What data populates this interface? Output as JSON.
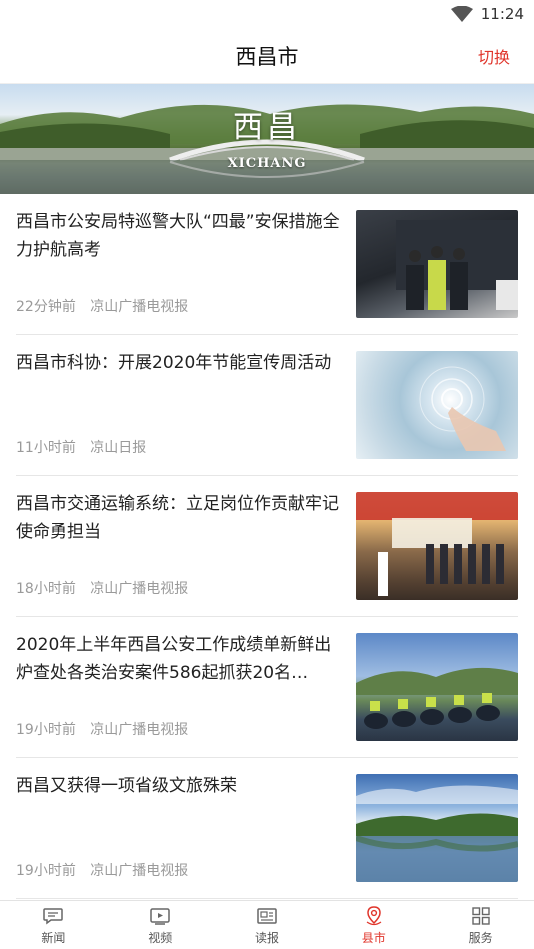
{
  "status_bar": {
    "time": "11:24"
  },
  "header": {
    "title": "西昌市",
    "switch_label": "切换"
  },
  "banner": {
    "title": "西昌",
    "subtitle": "XICHANG"
  },
  "news": [
    {
      "title": "西昌市公安局特巡警大队“四最”安保措施全力护航高考",
      "time": "22分钟前",
      "source": "凉山广播电视报"
    },
    {
      "title": "西昌市科协：开展2020年节能宣传周活动",
      "time": "11小时前",
      "source": "凉山日报"
    },
    {
      "title": "西昌市交通运输系统：立足岗位作贡献牢记使命勇担当",
      "time": "18小时前",
      "source": "凉山广播电视报"
    },
    {
      "title": "2020年上半年西昌公安工作成绩单新鲜出炉查处各类治安案件586起抓获20名…",
      "time": "19小时前",
      "source": "凉山广播电视报"
    },
    {
      "title": "西昌又获得一项省级文旅殊荣",
      "time": "19小时前",
      "source": "凉山广播电视报"
    }
  ],
  "tabs": [
    {
      "label": "新闻",
      "icon": "chat-bubble-icon",
      "active": false
    },
    {
      "label": "视频",
      "icon": "video-icon",
      "active": false
    },
    {
      "label": "读报",
      "icon": "newspaper-icon",
      "active": false
    },
    {
      "label": "县市",
      "icon": "location-pin-icon",
      "active": true
    },
    {
      "label": "服务",
      "icon": "grid-icon",
      "active": false
    }
  ],
  "colors": {
    "accent": "#e0352b",
    "meta_text": "#9a9a9a",
    "divider": "#e6e6e6"
  }
}
